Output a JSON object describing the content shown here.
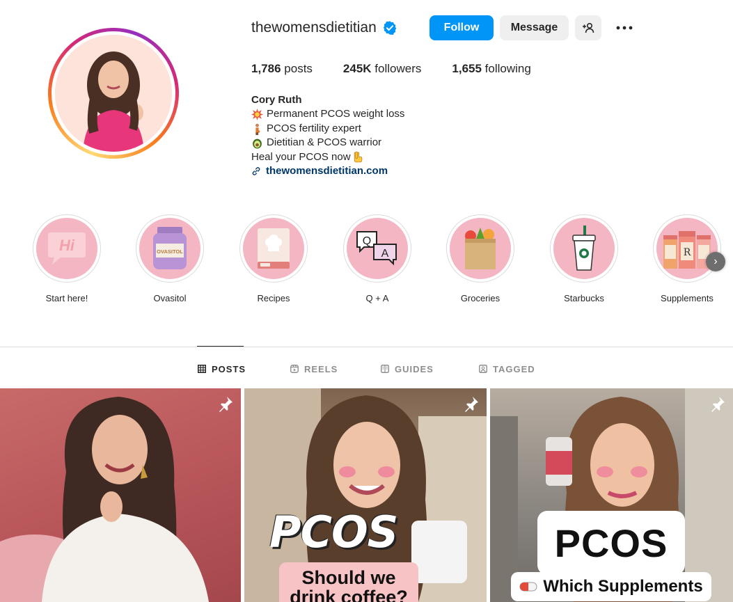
{
  "profile": {
    "username": "thewomensdietitian",
    "verified": true,
    "follow_label": "Follow",
    "message_label": "Message",
    "suggest_icon": "add-person-icon",
    "more_icon": "more-horizontal-icon"
  },
  "stats": {
    "posts_count": "1,786",
    "posts_label": "posts",
    "followers_count": "245K",
    "followers_label": "followers",
    "following_count": "1,655",
    "following_label": "following"
  },
  "bio": {
    "name": "Cory Ruth",
    "line1": "Permanent PCOS weight loss",
    "line2": "PCOS fertility expert",
    "line3": "Dietitian & PCOS warrior",
    "line4": "Heal your PCOS now",
    "link": "thewomensdietitian.com"
  },
  "highlights": [
    {
      "label": "Start here!",
      "icon": "hi-speech-bubble-icon"
    },
    {
      "label": "Ovasitol",
      "icon": "supplement-jar-icon"
    },
    {
      "label": "Recipes",
      "icon": "cookbook-icon"
    },
    {
      "label": "Q + A",
      "icon": "qa-bubbles-icon"
    },
    {
      "label": "Groceries",
      "icon": "grocery-bag-icon"
    },
    {
      "label": "Starbucks",
      "icon": "starbucks-cup-icon"
    },
    {
      "label": "Supplements",
      "icon": "pill-bottles-icon"
    }
  ],
  "highlight_jar_text": "OVASITOL",
  "highlight_hi_text": "Hi",
  "tabs": [
    {
      "label": "POSTS",
      "active": true
    },
    {
      "label": "REELS",
      "active": false
    },
    {
      "label": "GUIDES",
      "active": false
    },
    {
      "label": "TAGGED",
      "active": false
    }
  ],
  "posts": {
    "post2_overlay_title": "PCOS",
    "post2_overlay_sub1": "Should we",
    "post2_overlay_sub2": "drink coffee?",
    "post3_overlay_title": "PCOS",
    "post3_overlay_sub": "Which Supplements"
  },
  "colors": {
    "accent": "#0095f6",
    "link": "#00376b",
    "highlight_bg": "#f4b6c2"
  }
}
